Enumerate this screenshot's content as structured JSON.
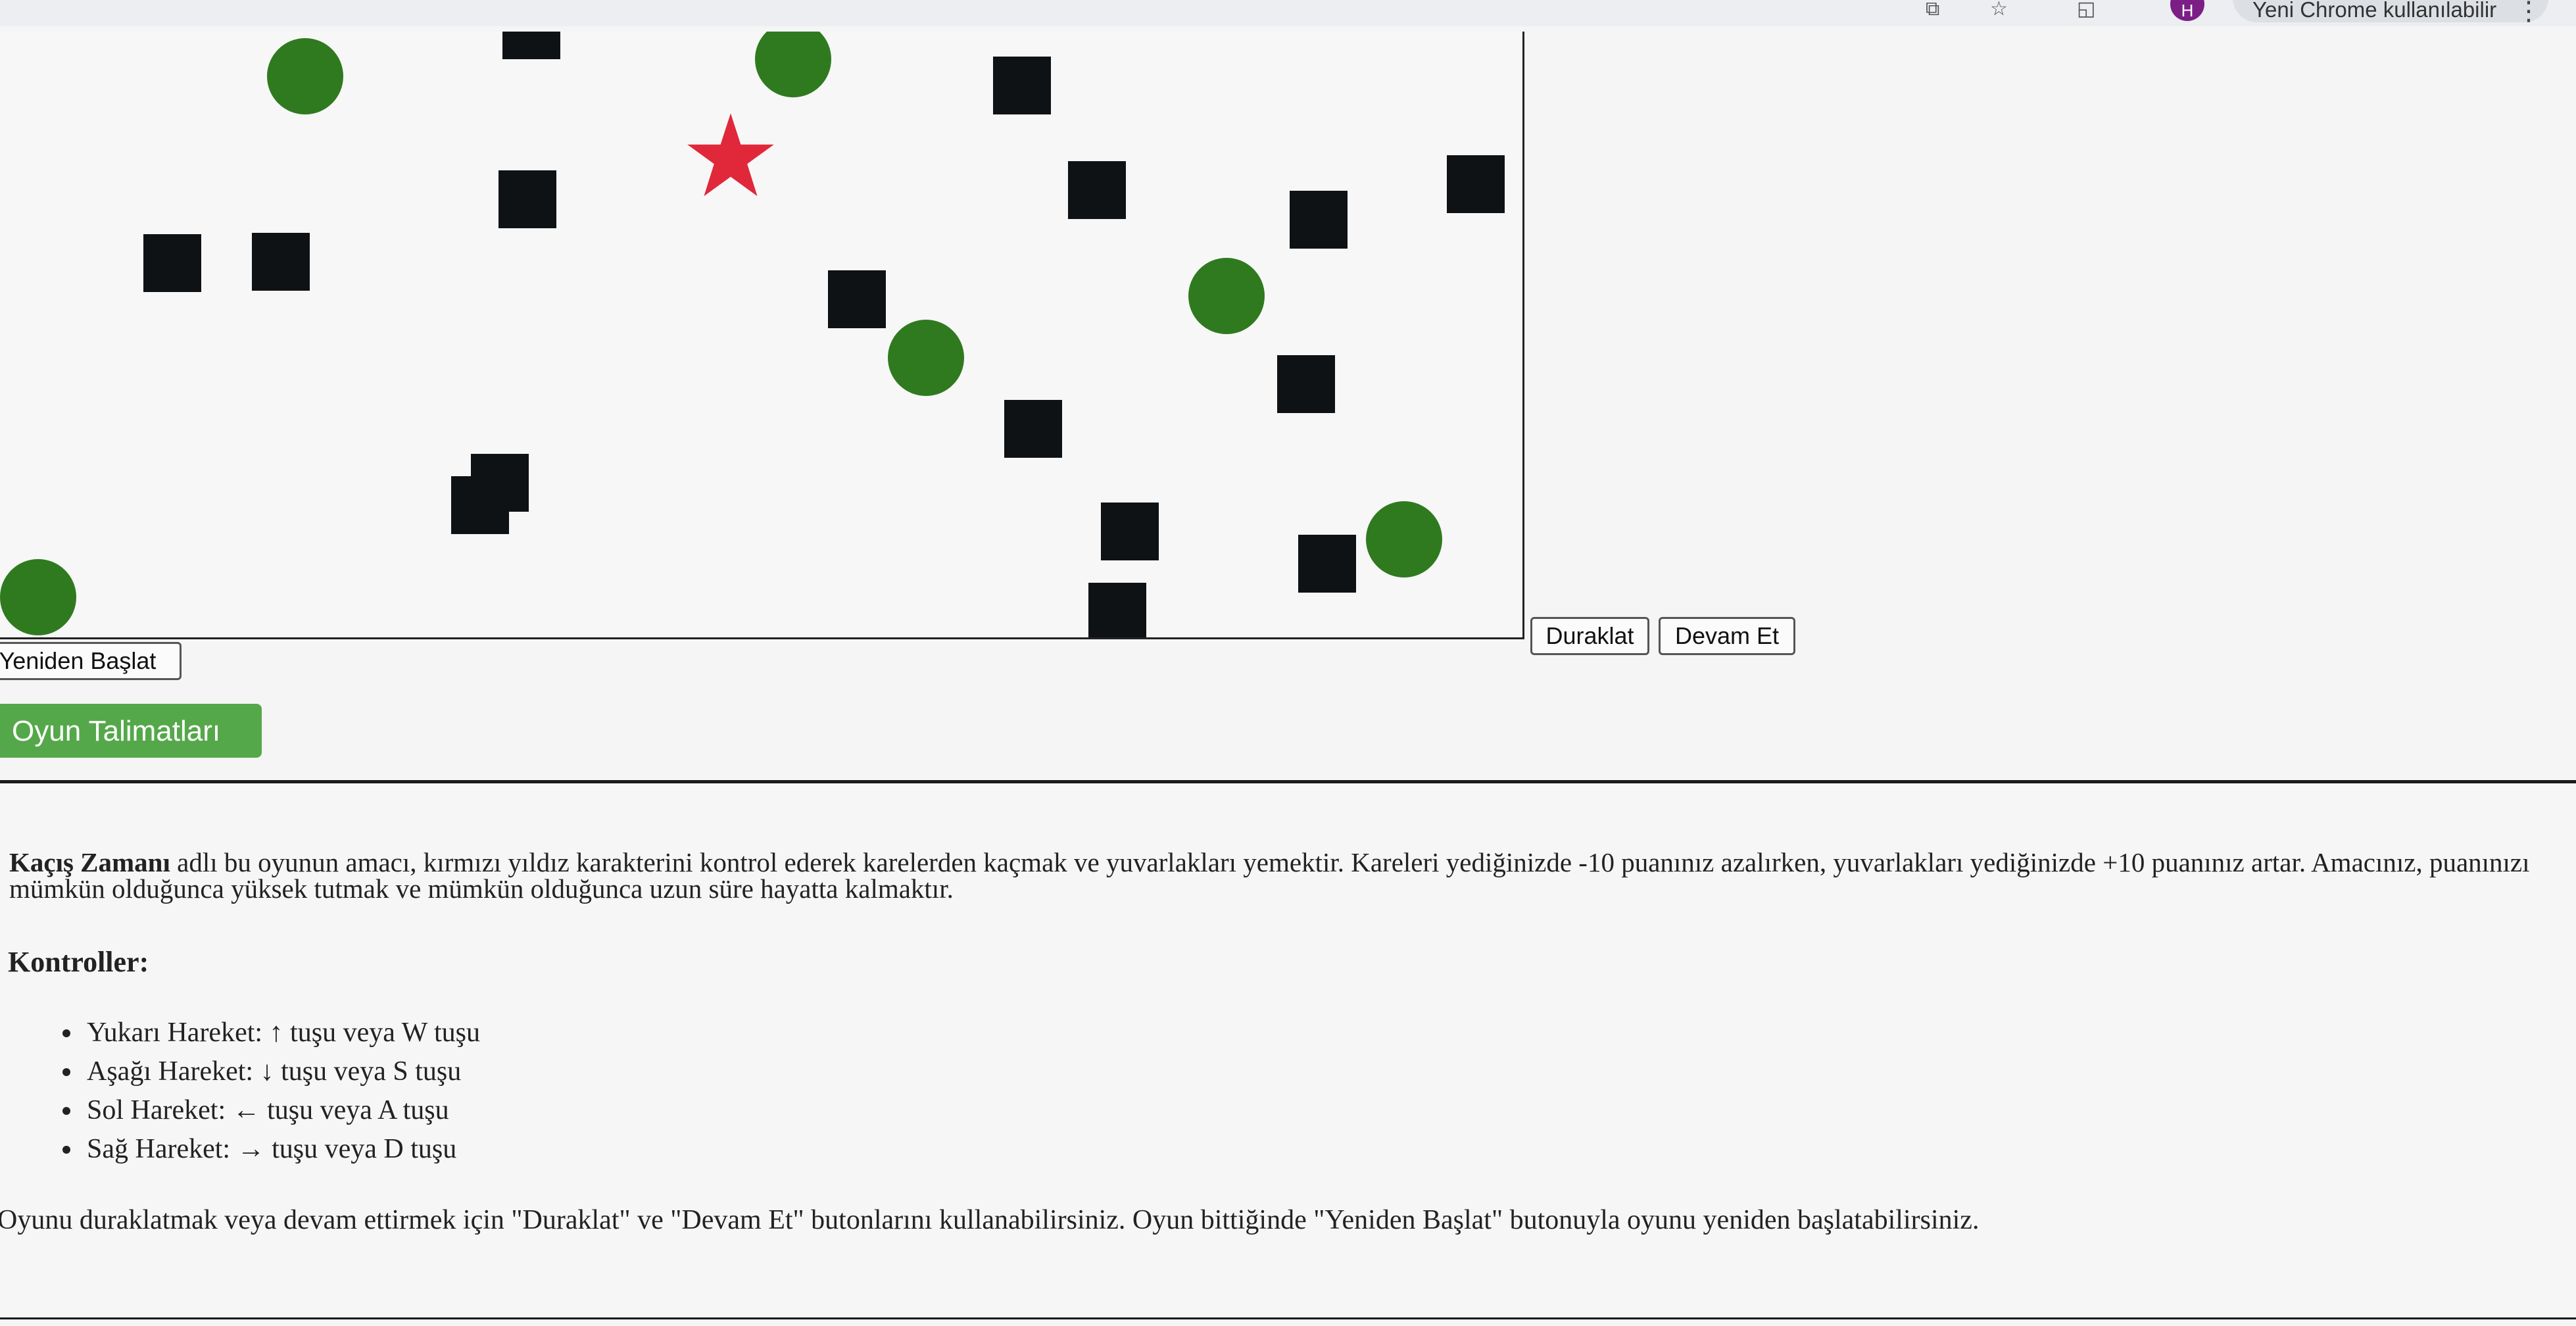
{
  "browser": {
    "profile_initial": "H",
    "update_label": "Yeni Chrome kullanılabilir",
    "menu_icon": "kebab-menu-icon",
    "toolbar_icons": [
      "screen-share-icon",
      "bookmark-star-icon",
      "extensions-icon"
    ]
  },
  "game": {
    "colors": {
      "square": "#0f1215",
      "circle": "#2f7a1f",
      "player_star": "#e0283a"
    },
    "square_count": 18,
    "circle_count": 6
  },
  "controls_bar": {
    "pause_label": "Duraklat",
    "resume_label": "Devam Et",
    "restart_label": "Yeniden Başlat",
    "instructions_label": "Oyun Talimatları"
  },
  "instructions": {
    "game_name": "Kaçış Zamanı",
    "intro_text": " adlı bu oyunun amacı, kırmızı yıldız karakterini kontrol ederek karelerden kaçmak ve yuvarlakları yemektir. Kareleri yediğinizde -10 puanınız azalırken, yuvarlakları yediğinizde +10 puanınız artar. Amacınız, puanınızı mümkün olduğunca yüksek tutmak ve mümkün olduğunca uzun süre hayatta kalmaktır.",
    "controls_heading": "Kontroller:",
    "controls": [
      "Yukarı Hareket: ↑ tuşu veya W tuşu",
      "Aşağı Hareket: ↓ tuşu veya S tuşu",
      "Sol Hareket: ← tuşu veya A tuşu",
      "Sağ Hareket: → tuşu veya D tuşu"
    ],
    "footer_text": "Oyunu duraklatmak veya devam ettirmek için \"Duraklat\" ve \"Devam Et\" butonlarını kullanabilirsiniz. Oyun bittiğinde \"Yeniden Başlat\" butonuyla oyunu yeniden başlatabilirsiniz."
  }
}
